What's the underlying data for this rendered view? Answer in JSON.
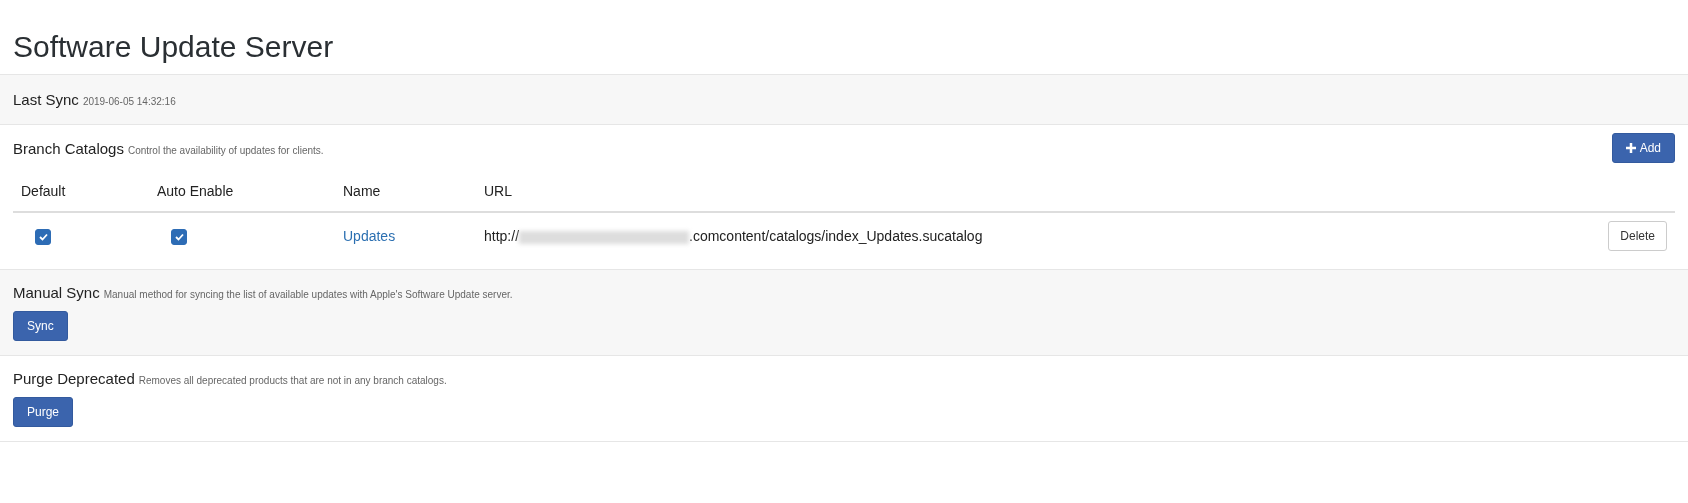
{
  "page_title": "Software Update Server",
  "last_sync": {
    "label": "Last Sync",
    "value": "2019-06-05 14:32:16"
  },
  "branch_catalogs": {
    "title": "Branch Catalogs",
    "description": "Control the availability of updates for clients.",
    "add_button": "Add",
    "columns": [
      "Default",
      "Auto Enable",
      "Name",
      "URL"
    ],
    "rows": [
      {
        "default": true,
        "auto_enable": true,
        "name": "Updates",
        "url_prefix": "http://",
        "url_redacted": true,
        "url_suffix": ".comcontent/catalogs/index_Updates.sucatalog",
        "action": "Delete"
      }
    ]
  },
  "sections": [
    {
      "title": "Manual Sync",
      "description": "Manual method for syncing the list of available updates with Apple's Software Update server.",
      "button": "Sync"
    },
    {
      "title": "Purge Deprecated",
      "description": "Removes all deprecated products that are not in any branch catalogs.",
      "button": "Purge"
    }
  ]
}
